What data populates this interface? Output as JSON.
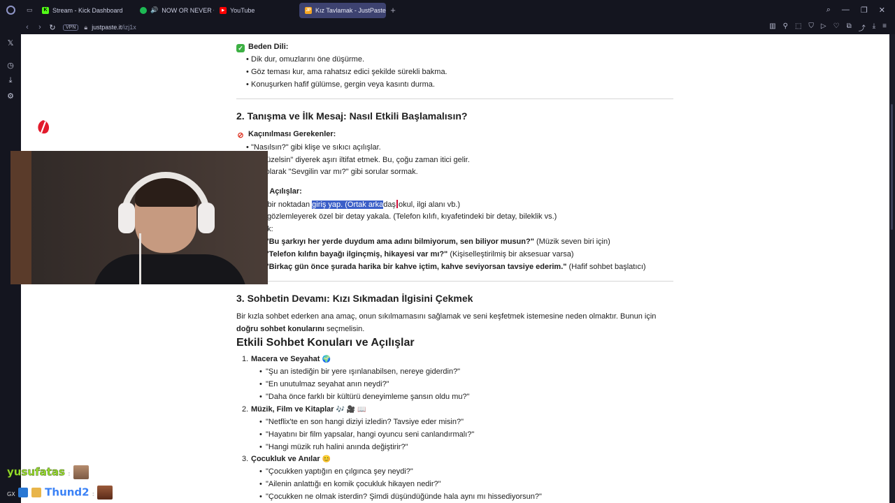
{
  "tabs": [
    {
      "label": "Stream - Kick Dashboard",
      "icon": "kick-icon",
      "color": "#53fc18"
    },
    {
      "label": "NOW OR NEVER • Tka",
      "icon": "spotify-icon",
      "color": "#1db954"
    },
    {
      "label": "YouTube",
      "icon": "youtube-icon",
      "color": "#ff0000"
    },
    {
      "label": "Kız Tavlamak - JustPaste.i",
      "icon": "justpaste-icon",
      "color": "#f5a623",
      "active": true
    }
  ],
  "address": {
    "vpn": "VPN",
    "host": "justpaste.it",
    "path": "/izj1x"
  },
  "doc": {
    "body_language_title": "Beden Dili:",
    "body_language": [
      "Dik dur, omuzlarını öne düşürme.",
      "Göz teması kur, ama rahatsız edici şekilde sürekli bakma.",
      "Konuşurken hafif gülümse, gergin veya kasıntı durma."
    ],
    "section2_title": "2. Tanışma ve İlk Mesaj: Nasıl Etkili Başlamalısın?",
    "avoid_title": "Kaçınılması Gerekenler:",
    "avoid": [
      "\"Nasılsın?\" gibi klişe ve sıkıcı açılışlar.",
      "güzelsin\" diyerek aşırı iltifat etmek. Bu, çoğu zaman itici gelir.",
      "kt olarak \"Sevgilin var mı?\" gibi sorular sormak."
    ],
    "good_title": "u Açılışlar:",
    "good_line1_pre": "k bir noktadan ",
    "good_line1_sel": "giriş yap. (Ortak arka",
    "good_line1_mid": "daş",
    "good_line1_post": "okul, ilgi alanı vb.)",
    "good_line2": "gözlemleyerek özel bir detay yakala. (Telefon kılıfı, kıyafetindeki bir detay, bileklik vs.)",
    "examples_label": "ek:",
    "examples": [
      {
        "bold": "'Bu şarkıyı her yerde duydum ama adını bilmiyorum, sen biliyor musun?\"",
        "note": " (Müzik seven biri için)"
      },
      {
        "bold": "'Telefon kılıfın bayağı ilginçmiş, hikayesi var mı?\"",
        "note": " (Kişiselleştirilmiş bir aksesuar varsa)"
      },
      {
        "bold": "'Birkaç gün önce şurada harika bir kahve içtim, kahve seviyorsan tavsiye ederim.\"",
        "note": " (Hafif sohbet başlatıcı)"
      }
    ],
    "section3_title": "3. Sohbetin Devamı: Kızı Sıkmadan İlgisini Çekmek",
    "section3_p1": "Bir kızla sohbet ederken ana amaç, onun sıkılmamasını sağlamak ve seni keşfetmek istemesine neden olmaktır. Bunun için",
    "section3_p2_bold": "doğru sohbet konularını",
    "section3_p2_rest": " seçmelisin.",
    "h1": "Etkili Sohbet Konuları ve Açılışlar",
    "topics": [
      {
        "num": "1.",
        "title": "Macera ve Seyahat",
        "emoji": "🌍",
        "items": [
          "\"Şu an istediğin bir yere ışınlanabilsen, nereye giderdin?\"",
          "\"En unutulmaz seyahat anın neydi?\"",
          "\"Daha önce farklı bir kültürü deneyimleme şansın oldu mu?\""
        ]
      },
      {
        "num": "2.",
        "title": "Müzik, Film ve Kitaplar",
        "emoji": "🎶 🎥 📖",
        "items": [
          "\"Netflix'te en son hangi diziyi izledin? Tavsiye eder misin?\"",
          "\"Hayatını bir film yapsalar, hangi oyuncu seni canlandırmalı?\"",
          "\"Hangi müzik ruh halini anında değiştirir?\""
        ]
      },
      {
        "num": "3.",
        "title": "Çocukluk ve Anılar",
        "emoji": "😊",
        "items": [
          "\"Çocukken yaptığın en çılgınca şey neydi?\"",
          "\"Ailenin anlattığı en komik çocukluk hikayen nedir?\"",
          "\"Çocukken ne olmak isterdin? Şimdi düşündüğünde hala aynı mı hissediyorsun?\""
        ]
      }
    ]
  },
  "chat": [
    {
      "prefix": "",
      "user": "yusufatas",
      "color": "#9be22d"
    },
    {
      "prefix": "GX",
      "user": "Thund2",
      "color": "#3b82f6"
    }
  ]
}
